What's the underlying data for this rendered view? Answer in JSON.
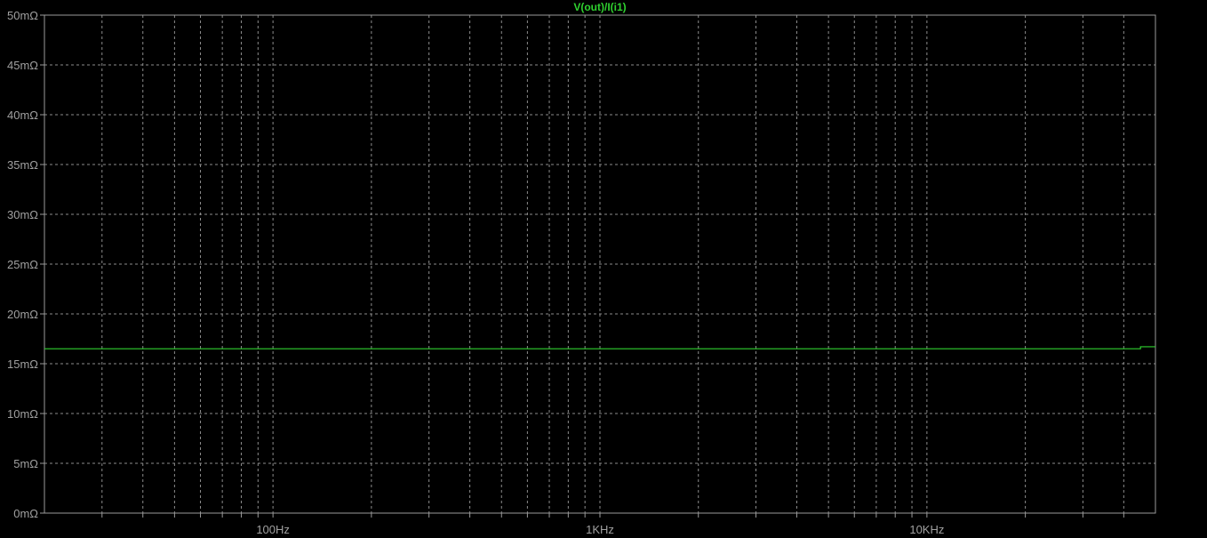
{
  "chart_data": {
    "type": "line",
    "title": "V(out)/I(i1)",
    "x_scale": "log",
    "xlim": [
      20,
      50000
    ],
    "ylim": [
      0,
      50
    ],
    "y_unit": "mΩ",
    "y_ticks": [
      {
        "value": 0,
        "label": "0mΩ"
      },
      {
        "value": 5,
        "label": "5mΩ"
      },
      {
        "value": 10,
        "label": "10mΩ"
      },
      {
        "value": 15,
        "label": "15mΩ"
      },
      {
        "value": 20,
        "label": "20mΩ"
      },
      {
        "value": 25,
        "label": "25mΩ"
      },
      {
        "value": 30,
        "label": "30mΩ"
      },
      {
        "value": 35,
        "label": "35mΩ"
      },
      {
        "value": 40,
        "label": "40mΩ"
      },
      {
        "value": 45,
        "label": "45mΩ"
      },
      {
        "value": 50,
        "label": "50mΩ"
      }
    ],
    "x_ticks": [
      {
        "value": 100,
        "label": "100Hz"
      },
      {
        "value": 1000,
        "label": "1KHz"
      },
      {
        "value": 10000,
        "label": "10KHz"
      }
    ],
    "grid": true,
    "series": [
      {
        "name": "V(out)/I(i1)",
        "color": "#2fd12f",
        "x": [
          20,
          45000,
          45000,
          50000
        ],
        "y": [
          16.5,
          16.5,
          16.7,
          16.7
        ]
      }
    ]
  },
  "colors": {
    "background": "#000000",
    "axis": "#9a9a9a",
    "grid": "#8c8c8c",
    "label": "#a0a0a0"
  }
}
